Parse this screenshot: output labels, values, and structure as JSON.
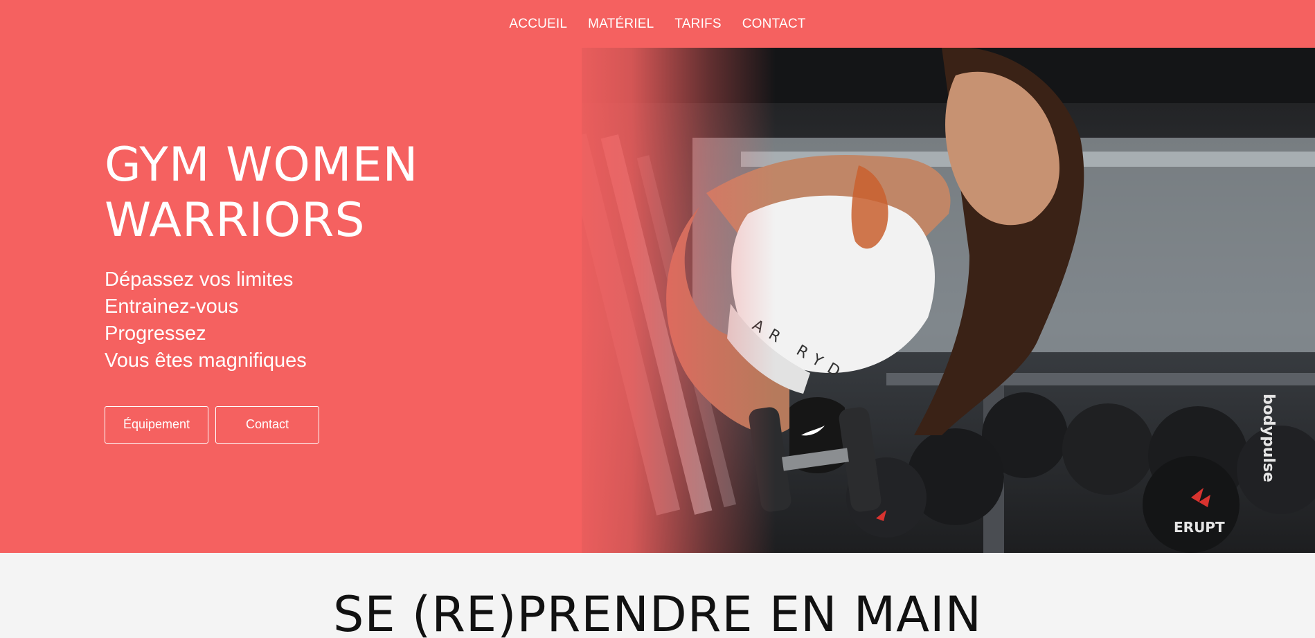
{
  "nav": {
    "items": [
      {
        "label": "ACCUEIL"
      },
      {
        "label": "MATÉRIEL"
      },
      {
        "label": "TARIFS"
      },
      {
        "label": "CONTACT"
      }
    ]
  },
  "hero": {
    "title_line1": "GYM WOMEN",
    "title_line2": "WARRIORS",
    "taglines": [
      "Dépassez vos limites",
      "Entrainez-vous",
      "Progressez",
      "Vous êtes magnifiques"
    ],
    "buttons": {
      "equipment": "Équipement",
      "contact": "Contact"
    },
    "image_text": {
      "shirt": "AR RYD",
      "weights_brand": "ERUPT",
      "rack_brand": "bodypulse"
    }
  },
  "section": {
    "title": "SE (RE)PRENDRE EN MAIN"
  },
  "colors": {
    "accent": "#f56160",
    "text_light": "#ffffff",
    "section_bg": "#f4f4f4",
    "section_text": "#111111"
  },
  "icons": {
    "glove_logo": "swoosh-icon"
  }
}
